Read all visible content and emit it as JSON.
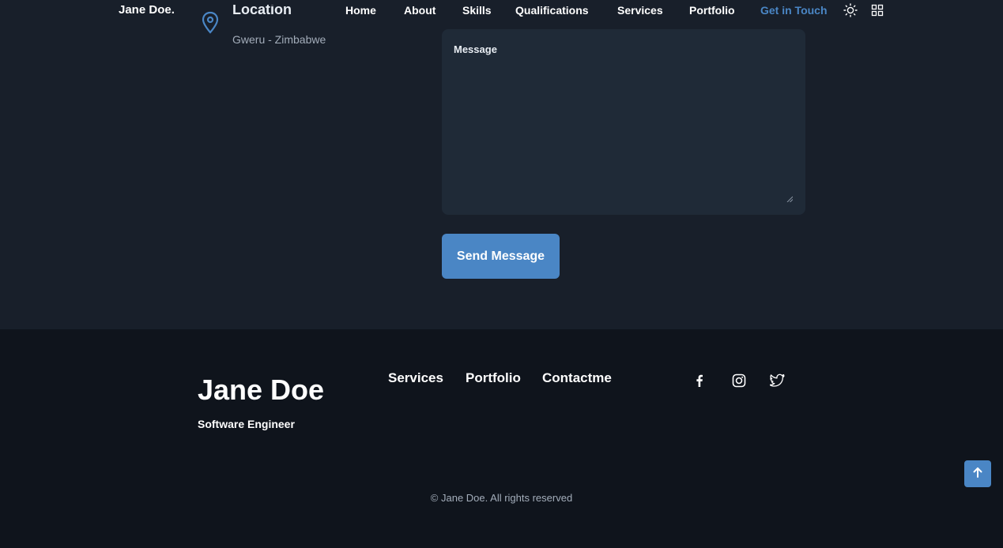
{
  "header": {
    "brand": "Jane Doe.",
    "nav": [
      "Home",
      "About",
      "Skills",
      "Qualifications",
      "Services",
      "Portfolio",
      "Get in Touch"
    ],
    "active_nav": "Get in Touch",
    "theme_icon": "sun-icon",
    "menu_icon": "grid-icon"
  },
  "contact": {
    "location_title": "Location",
    "location_value": "Gweru - Zimbabwe",
    "message_label": "Message",
    "send_label": "Send Message"
  },
  "footer": {
    "name": "Jane Doe",
    "role": "Software Engineer",
    "links": [
      "Services",
      "Portfolio",
      "Contactme"
    ],
    "social": [
      "facebook-icon",
      "instagram-icon",
      "twitter-icon"
    ],
    "copyright": "© Jane Doe. All rights reserved"
  },
  "colors": {
    "accent": "#4a86c5",
    "background": "#181f2a",
    "footer_background": "#0f141c",
    "input_background": "#1f2a37"
  }
}
